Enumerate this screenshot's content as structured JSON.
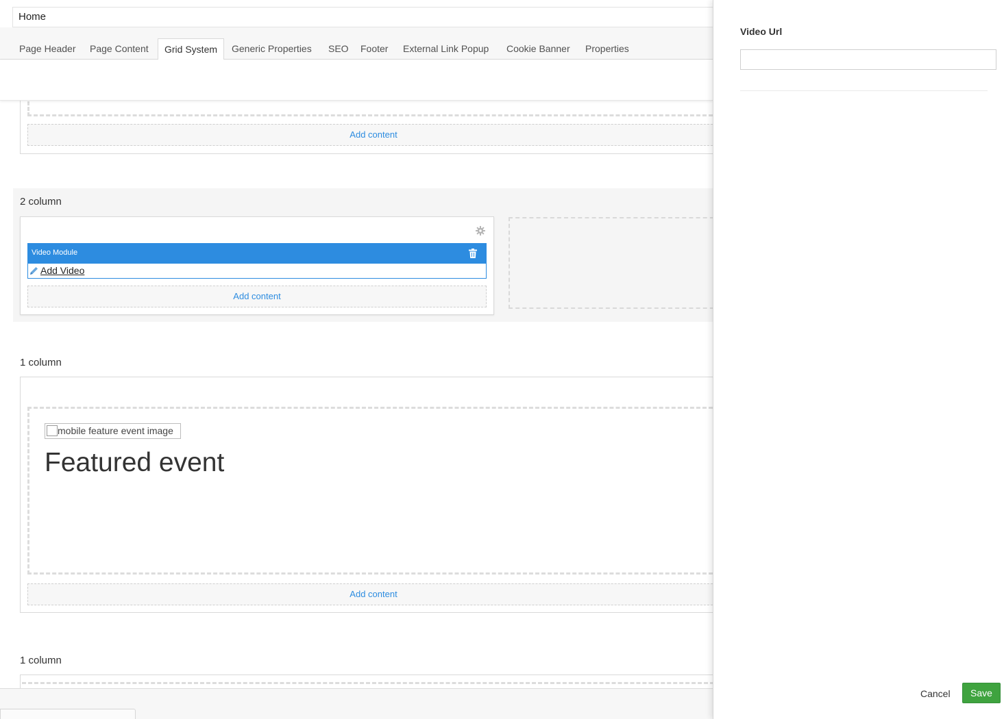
{
  "page": {
    "name": "Home"
  },
  "tabs": [
    {
      "label": "Page Header"
    },
    {
      "label": "Page Content"
    },
    {
      "label": "Grid System",
      "active": true
    },
    {
      "label": "Generic Properties"
    },
    {
      "label": "SEO"
    },
    {
      "label": "Footer"
    },
    {
      "label": "External Link Popup"
    },
    {
      "label": "Cookie Banner"
    },
    {
      "label": "Properties"
    }
  ],
  "grid": {
    "top_section": {
      "add_content_label": "Add content"
    },
    "two_column": {
      "label": "2 column",
      "module": {
        "title": "Video Module",
        "link_label": "Add Video"
      },
      "add_content_label": "Add content"
    },
    "one_column_a": {
      "label": "1 column",
      "image_alt": "mobile feature event image",
      "heading": "Featured event",
      "add_content_label": "Add content"
    },
    "one_column_b": {
      "label": "1 column"
    }
  },
  "panel": {
    "field_label": "Video Url",
    "field_value": "",
    "cancel_label": "Cancel",
    "save_label": "Save"
  },
  "colors": {
    "accent": "#2d8ce0",
    "save": "#3fa33f"
  }
}
